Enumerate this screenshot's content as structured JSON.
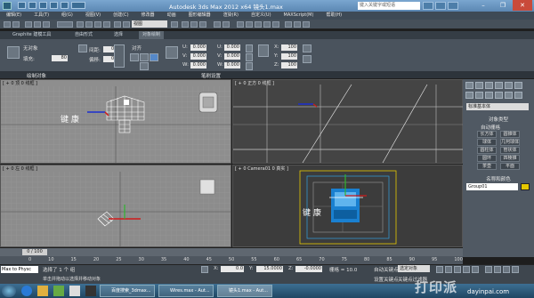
{
  "titlebar": {
    "title": "Autodesk 3ds Max  2012 x64      镜头1.max",
    "search_placeholder": "键入关键字或短语"
  },
  "menubar": [
    "编辑(E)",
    "工具(T)",
    "组(G)",
    "视图(V)",
    "创建(C)",
    "修改器",
    "动画",
    "图形编辑器",
    "渲染(R)",
    "自定义(U)",
    "MAXScript(M)",
    "帮助(H)"
  ],
  "toolbar": {
    "select_value": "视图"
  },
  "ribbon": {
    "tabs": [
      "Graphite 建模工具",
      "自由形式",
      "选择",
      "对象绘制"
    ],
    "paint_label": "无对象",
    "fill_label": "填充:",
    "fill_value": "80",
    "scatter_label": "间距:",
    "scatter_value": "0.0",
    "offset_label": "偏移:",
    "align_label": "对齐",
    "u_label": "U:",
    "v_label": "V:",
    "w_label": "W:",
    "u_value": "0.000",
    "v_value": "0.000",
    "w_value": "0.000",
    "x_label": "X:",
    "y_label": "Y:",
    "z_label": "Z:",
    "x_value": "100",
    "y_value": "100",
    "z_value": "100",
    "footer_left": "绘制对象",
    "footer_right": "笔刷设置"
  },
  "viewports": {
    "top": "[ + 0 顶 0 线框 ]",
    "front": "[ + 0 正方 0 线框 ]",
    "left": "[ + 0 左 0 线框 ]",
    "persp": "[ + 0 Camera01 0 真实 ]",
    "text_top": "键 康",
    "text_persp": "键 康"
  },
  "command_panel": {
    "dropdown": "标准基本体",
    "object_type_title": "对象类型",
    "autogrid": "自动栅格",
    "buttons": [
      [
        "长方体",
        "圆锥体"
      ],
      [
        "球体",
        "几何球体"
      ],
      [
        "圆柱体",
        "管状体"
      ],
      [
        "圆环",
        "四棱锥"
      ],
      [
        "茶壶",
        "平面"
      ]
    ],
    "name_color_title": "名称和颜色",
    "object_name": "Group01"
  },
  "timeline": {
    "slider": "0 / 100",
    "ticks": [
      "0",
      "10",
      "15",
      "20",
      "25",
      "30",
      "35",
      "40",
      "45",
      "50",
      "55",
      "60",
      "65",
      "70",
      "75",
      "80",
      "85",
      "90",
      "95",
      "100"
    ]
  },
  "status": {
    "listener": "Max to Physc",
    "selected": "选择了 1 个 组",
    "prompt": "单击并拖动以选择并移动对象",
    "x_label": "X:",
    "x_value": "0.0",
    "y_label": "Y:",
    "y_value": "15.0000",
    "z_label": "Z:",
    "z_value": "-0.0000",
    "grid": "栅格 = 10.0",
    "autokey": "自动关键点",
    "set_key": "设置关键点",
    "key_filter": "选定对象",
    "key_filters_label": "关键点过滤器"
  },
  "taskbar": {
    "items": [
      "百度搜索_3dmax...",
      "Wires.max - Aut...",
      "镜头1.max - Aut..."
    ]
  },
  "watermark": "打印派",
  "watermark_sub": "dayinpai.com",
  "colors": {
    "accent": "#5b87b3",
    "viewport": "#8e8e8e",
    "selection_yellow": "#e6c800"
  }
}
